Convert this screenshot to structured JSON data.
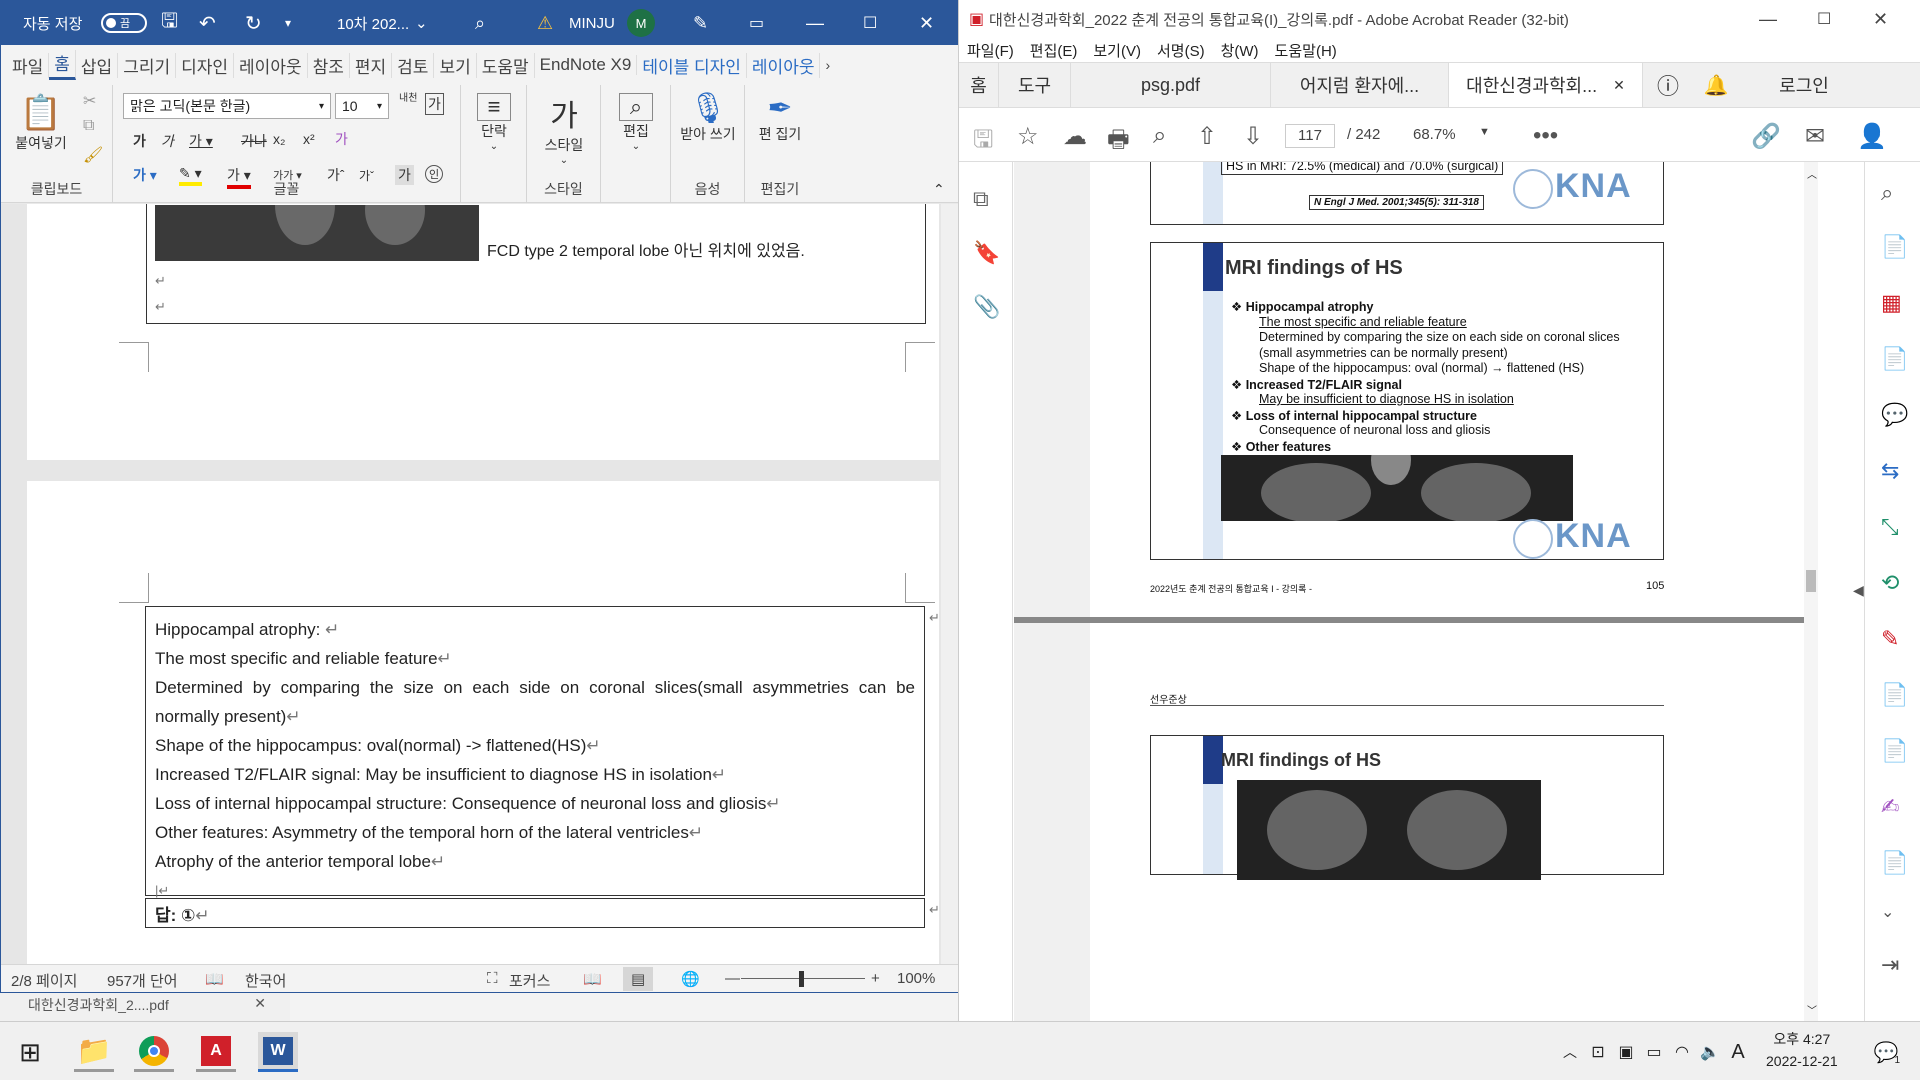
{
  "word": {
    "autosave_label": "자동 저장",
    "autosave_state": "끔",
    "doc_title": "10차 202...",
    "user_name": "MINJU",
    "user_initial": "M",
    "tabs": [
      "파일",
      "홈",
      "삽입",
      "그리기",
      "디자인",
      "레이아웃",
      "참조",
      "편지",
      "검토",
      "보기",
      "도움말",
      "EndNote X9",
      "테이블 디자인",
      "레이아웃"
    ],
    "active_tab": "홈",
    "ribbon": {
      "paste_label": "붙여넣기",
      "clipboard_label": "클립보드",
      "font_name": "맑은 고딕(본문 한글)",
      "font_size": "10",
      "font_group_label": "글꼴",
      "paragraph_label": "단락",
      "style_label": "스타일",
      "style_group_label": "스타일",
      "edit_label": "편집",
      "dictate_label": "받아 쓰기",
      "voice_label": "음성",
      "editor_label": "편 집기",
      "editor_group_label": "편집기"
    },
    "doc": {
      "fcd_note": "FCD type 2 temporal lobe 아닌 위치에 있었음.",
      "lines": [
        "Hippocampal atrophy: ",
        "The most specific and reliable feature",
        "Determined by comparing the size on each side on coronal slices(small asymmetries can be normally present)",
        "Shape of the hippocampus: oval(normal) -> flattened(HS)",
        "Increased T2/FLAIR signal: May be insufficient to diagnose HS in isolation",
        "Loss of internal hippocampal structure: Consequence of neuronal loss and gliosis",
        "Other features: Asymmetry of the temporal horn of the lateral ventricles",
        "Atrophy of the anterior temporal lobe"
      ],
      "answer": "답: ①"
    },
    "status": {
      "page": "2/8 페이지",
      "words": "957개 단어",
      "language": "한국어",
      "focus": "포커스",
      "zoom": "100%"
    }
  },
  "acrobat": {
    "title": "대한신경과학회_2022 춘계 전공의 통합교육(I)_강의록.pdf - Adobe Acrobat Reader (32-bit)",
    "menu": [
      "파일(F)",
      "편집(E)",
      "보기(V)",
      "서명(S)",
      "창(W)",
      "도움말(H)"
    ],
    "nav_tabs": [
      "홈",
      "도구"
    ],
    "doc_tabs": [
      "psg.pdf",
      "어지럼 환자에...",
      "대한신경과학회..."
    ],
    "login": "로그인",
    "page_current": "117",
    "page_total": "/ 242",
    "zoom": "68.7%",
    "slide1": {
      "stat": "HS in MRI: 72.5% (medical) and 70.0% (surgical)",
      "citation": "N Engl J Med. 2001;345(5): 311-318",
      "logo": "KNA"
    },
    "slide2": {
      "title": "MRI findings of HS",
      "items": [
        {
          "text": "Hippocampal atrophy",
          "level": 0
        },
        {
          "text": "The most specific and reliable feature",
          "level": 1
        },
        {
          "text": "Determined by comparing the size on each side on coronal slices",
          "level": 1
        },
        {
          "text": "(small asymmetries can be normally present)",
          "level": 1
        },
        {
          "text": "Shape of the hippocampus: oval (normal) → flattened (HS)",
          "level": 1
        },
        {
          "text": "Increased T2/FLAIR signal",
          "level": 0
        },
        {
          "text": "May be insufficient to diagnose HS in isolation",
          "level": 1
        },
        {
          "text": "Loss of internal hippocampal structure",
          "level": 0
        },
        {
          "text": "Consequence of neuronal loss and gliosis",
          "level": 1
        },
        {
          "text": "Other features",
          "level": 0
        },
        {
          "text": "Asymmetry of the temporal horn of the lateral ventricles",
          "level": 1
        },
        {
          "text": "Atrophy of the anterior temporal lobe",
          "level": 1
        }
      ],
      "logo": "KNA"
    },
    "page_footer_left": "2022년도 춘계 전공의 통합교육 I - 강의록 -",
    "page_footer_right": "105",
    "next_header": "선우준상",
    "slide3_title": "MRI findings of HS"
  },
  "taskbar": {
    "time": "오후 4:27",
    "date": "2022-12-21",
    "ime": "A",
    "notif": "1",
    "behind_window": "대한신경과학회_2....pdf"
  }
}
